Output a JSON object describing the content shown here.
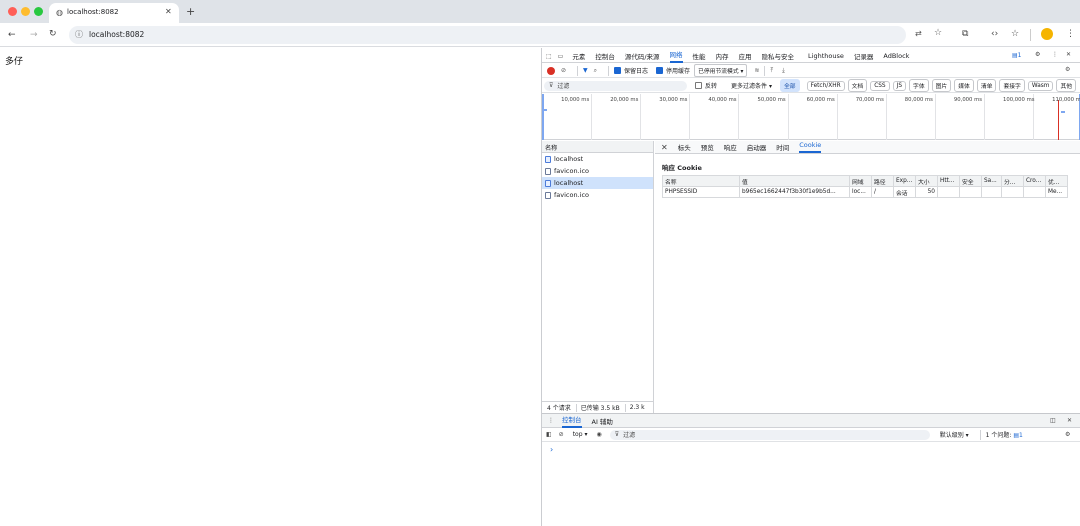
{
  "window": {
    "tab_title": "localhost:8082",
    "url": "localhost:8082",
    "icons": [
      "close-traffic-light",
      "minimize-traffic-light",
      "maximize-traffic-light",
      "globe-icon",
      "close-icon",
      "plus-icon",
      "back-icon",
      "forward-icon",
      "reload-icon",
      "info-icon",
      "translate-icon",
      "star-icon",
      "extensions-icon",
      "code-icon",
      "bookmark-icon",
      "profile-avatar",
      "menu-icon"
    ],
    "colors": {
      "close": "#ff5f57",
      "minimize": "#febc2e",
      "maximize": "#28c840",
      "accent": "#1a66d2"
    }
  },
  "page": {
    "text": "多仔"
  },
  "devtools": {
    "tabs": [
      "元素",
      "控制台",
      "源代码/来源",
      "网络",
      "性能",
      "内存",
      "应用",
      "隐私与安全",
      "Lighthouse",
      "记录器",
      "AdBlock"
    ],
    "active_tab": "网络",
    "issues_badge": "1",
    "network_toolbar": {
      "preserve_log": "保留日志",
      "disable_cache": "停用缓存",
      "throttle": "已停用节流模式"
    },
    "filter_bar": {
      "placeholder": "过滤",
      "invert": "反转",
      "more_filters": "更多过滤条件",
      "types": [
        "全部",
        "Fetch/XHR",
        "文档",
        "CSS",
        "JS",
        "字体",
        "图片",
        "媒体",
        "清单",
        "套接字",
        "Wasm",
        "其他"
      ]
    },
    "timeline_ticks": [
      "10,000 ms",
      "20,000 ms",
      "30,000 ms",
      "40,000 ms",
      "50,000 ms",
      "60,000 ms",
      "70,000 ms",
      "80,000 ms",
      "90,000 ms",
      "100,000 ms",
      "110,000 m"
    ],
    "request_list": {
      "header": "名称",
      "items": [
        {
          "name": "localhost",
          "type": "page",
          "selected": false
        },
        {
          "name": "favicon.ico",
          "type": "file",
          "selected": false
        },
        {
          "name": "localhost",
          "type": "page",
          "selected": true
        },
        {
          "name": "favicon.ico",
          "type": "file",
          "selected": false
        }
      ]
    },
    "detail_tabs": [
      "标头",
      "预览",
      "响应",
      "启动器",
      "时间",
      "Cookie"
    ],
    "active_detail_tab": "Cookie",
    "response_cookie_title": "响应 Cookie",
    "cookie_columns": [
      "名称",
      "值",
      "网域",
      "路径",
      "Exp...",
      "大小",
      "Htt...",
      "安全",
      "Sa...",
      "分...",
      "Cro...",
      "优..."
    ],
    "cookie_rows": [
      [
        "PHPSESSID",
        "b965ec1662447f3b30f1e9b5d...",
        "loc...",
        "/",
        "会话",
        "50",
        "",
        "",
        "",
        "",
        "",
        "Me..."
      ]
    ],
    "status": {
      "requests": "4 个请求",
      "transferred": "已传输 3.5 kB",
      "resources": "2.3 k"
    },
    "drawer": {
      "tabs": [
        "控制台",
        "AI 辅助"
      ],
      "active_tab": "控制台",
      "context": "top",
      "filter_placeholder": "过滤",
      "levels": "默认级别",
      "issues": "1 个问题:",
      "issues_count": "1",
      "prompt": "›"
    }
  }
}
